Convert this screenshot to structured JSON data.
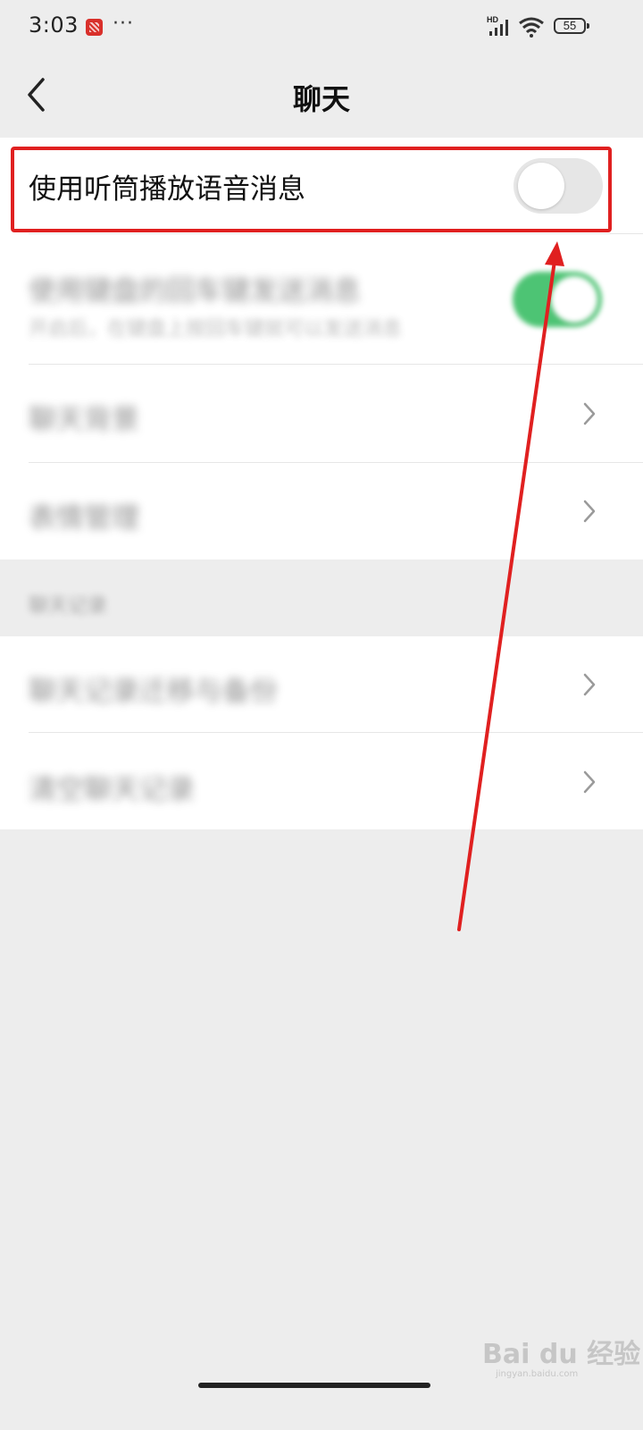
{
  "status_bar": {
    "time": "3:03",
    "dots": "···",
    "network_type": "HD",
    "battery_level": "55"
  },
  "header": {
    "title": "聊天"
  },
  "settings": [
    {
      "label": "使用听筒播放语音消息",
      "toggle": "off",
      "highlighted": true
    },
    {
      "label": "使用键盘的回车键发送消息",
      "sublabel": "开启后，在键盘上按回车键就可以发送消息",
      "toggle": "on",
      "obscured": true
    },
    {
      "label": "聊天背景",
      "obscured": true
    },
    {
      "label": "表情管理",
      "obscured": true
    }
  ],
  "section2": {
    "header": "聊天记录",
    "items": [
      {
        "label": "聊天记录迁移与备份",
        "obscured": true
      },
      {
        "label": "清空聊天记录",
        "obscured": true
      }
    ]
  },
  "watermark": {
    "text": "Bai du 经验",
    "sub": "jingyan.baidu.com"
  },
  "colors": {
    "highlight": "#e02020",
    "toggle_on": "#2fba5c",
    "toggle_off": "#e6e6e6",
    "background": "#ededed"
  }
}
